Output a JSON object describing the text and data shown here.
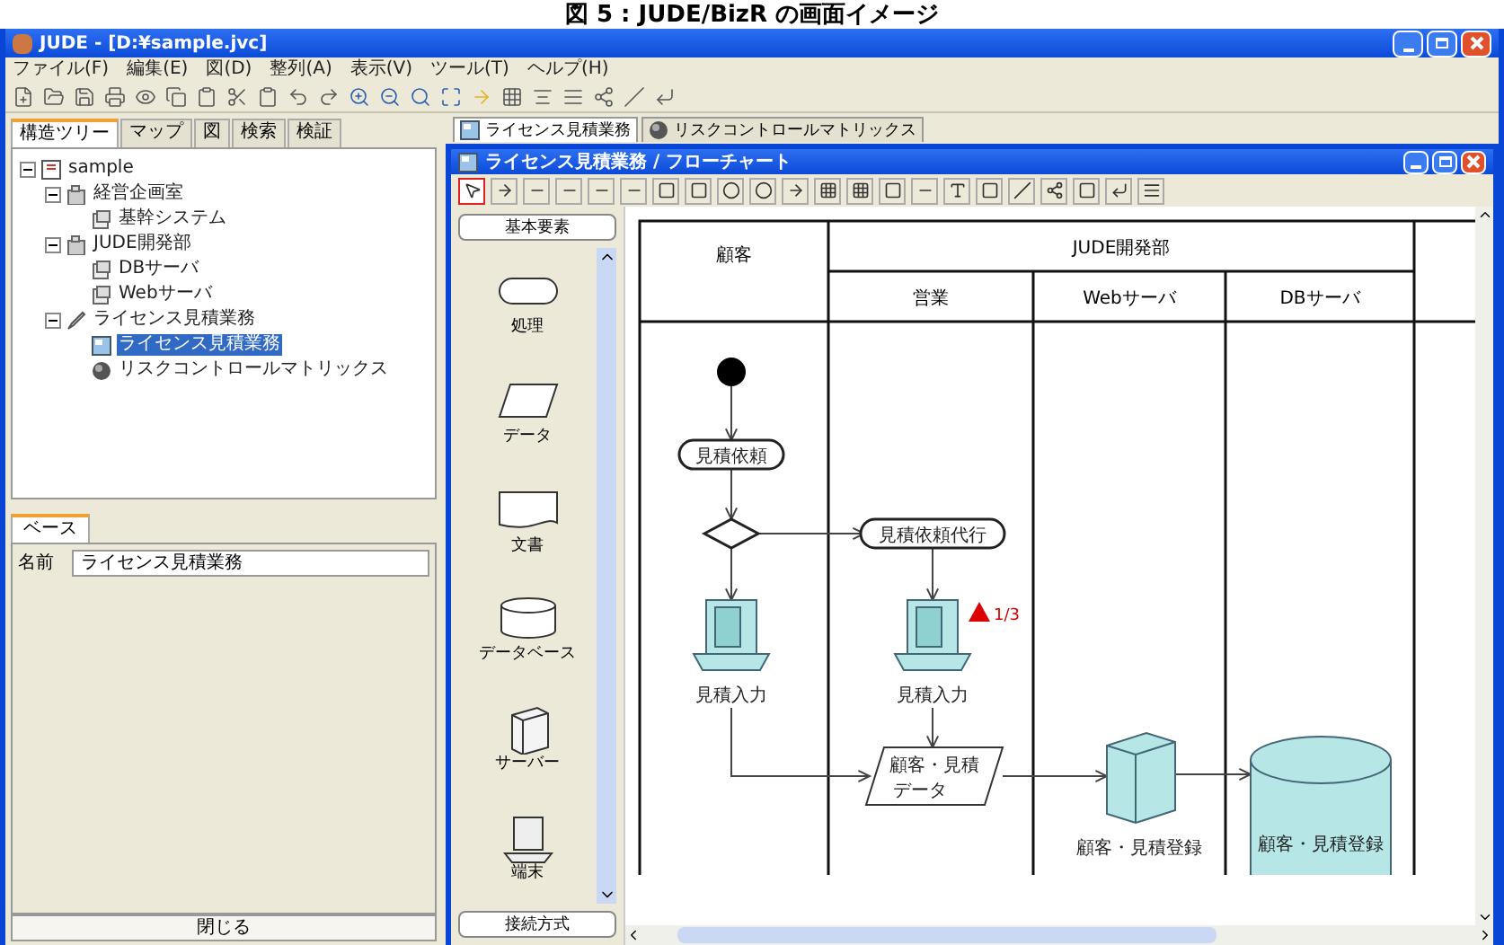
{
  "caption": "図 5 : JUDE/BizR の画面イメージ",
  "window": {
    "title": "JUDE - [D:¥sample.jvc]"
  },
  "menu": [
    "ファイル(F)",
    "編集(E)",
    "図(D)",
    "整列(A)",
    "表示(V)",
    "ツール(T)",
    "ヘルプ(H)"
  ],
  "left_tabs": [
    {
      "label": "構造ツリー",
      "selected": true
    },
    {
      "label": "マップ",
      "selected": false
    },
    {
      "label": "図",
      "selected": false
    },
    {
      "label": "検索",
      "selected": false
    },
    {
      "label": "検証",
      "selected": false
    }
  ],
  "tree": [
    {
      "label": "sample",
      "kind": "project",
      "expanded": true,
      "selected": false,
      "children": [
        {
          "label": "経営企画室",
          "kind": "org",
          "expanded": true,
          "selected": false,
          "children": [
            {
              "label": "基幹システム",
              "kind": "system",
              "selected": false
            }
          ]
        },
        {
          "label": "JUDE開発部",
          "kind": "org",
          "expanded": true,
          "selected": false,
          "children": [
            {
              "label": "DBサーバ",
              "kind": "system",
              "selected": false
            },
            {
              "label": "Webサーバ",
              "kind": "system",
              "selected": false
            }
          ]
        },
        {
          "label": "ライセンス見積業務",
          "kind": "process",
          "expanded": true,
          "selected": false,
          "children": [
            {
              "label": "ライセンス見積業務",
              "kind": "flowchart",
              "selected": true
            },
            {
              "label": "リスクコントロールマトリックス",
              "kind": "matrix",
              "selected": false
            }
          ]
        }
      ]
    }
  ],
  "property_tabs": [
    {
      "label": "ベース",
      "selected": true
    }
  ],
  "property": {
    "label": "名前",
    "value": "ライセンス見積業務"
  },
  "close_button": "閉じる",
  "doc_tabs": [
    {
      "label": "ライセンス見積業務",
      "kind": "flowchart",
      "selected": true
    },
    {
      "label": "リスクコントロールマトリックス",
      "kind": "matrix",
      "selected": false
    }
  ],
  "diagram_window": {
    "title": "ライセンス見積業務 / フローチャート"
  },
  "diagram_tools": [
    {
      "selected": true
    },
    {
      "selected": false
    },
    {
      "selected": false
    },
    {
      "selected": false
    },
    {
      "selected": false
    },
    {
      "selected": false
    },
    {
      "selected": false
    },
    {
      "selected": false
    },
    {
      "selected": false
    },
    {
      "selected": false
    },
    {
      "selected": false
    },
    {
      "selected": false
    },
    {
      "selected": false
    },
    {
      "selected": false
    },
    {
      "selected": false
    },
    {
      "selected": false
    },
    {
      "selected": false
    },
    {
      "selected": false
    },
    {
      "selected": false
    },
    {
      "selected": false
    },
    {
      "selected": false
    },
    {
      "selected": false
    }
  ],
  "palette": {
    "header": "基本要素",
    "footer": "接続方式",
    "items": [
      {
        "label": "処理",
        "kind": "process"
      },
      {
        "label": "データ",
        "kind": "data"
      },
      {
        "label": "文書",
        "kind": "document"
      },
      {
        "label": "データベース",
        "kind": "database"
      },
      {
        "label": "サーバー",
        "kind": "server"
      },
      {
        "label": "端末",
        "kind": "terminal"
      }
    ]
  },
  "swimlanes": {
    "lane_1": "顧客",
    "group": "JUDE開発部",
    "group_lanes": [
      "営業",
      "Webサーバ",
      "DBサーバ"
    ]
  },
  "nodes": [
    {
      "kind": "start"
    },
    {
      "kind": "action",
      "label": "見積依頼"
    },
    {
      "kind": "decision"
    },
    {
      "kind": "action",
      "label": "見積依頼代行"
    },
    {
      "kind": "terminal",
      "label": "見積入力"
    },
    {
      "kind": "terminal",
      "label": "見積入力",
      "badge": "1/3"
    },
    {
      "kind": "data",
      "label": "顧客・見積",
      "label_2": "データ"
    },
    {
      "kind": "server",
      "label": "顧客・見積登録"
    },
    {
      "kind": "database",
      "label": "顧客・見積登録"
    }
  ]
}
